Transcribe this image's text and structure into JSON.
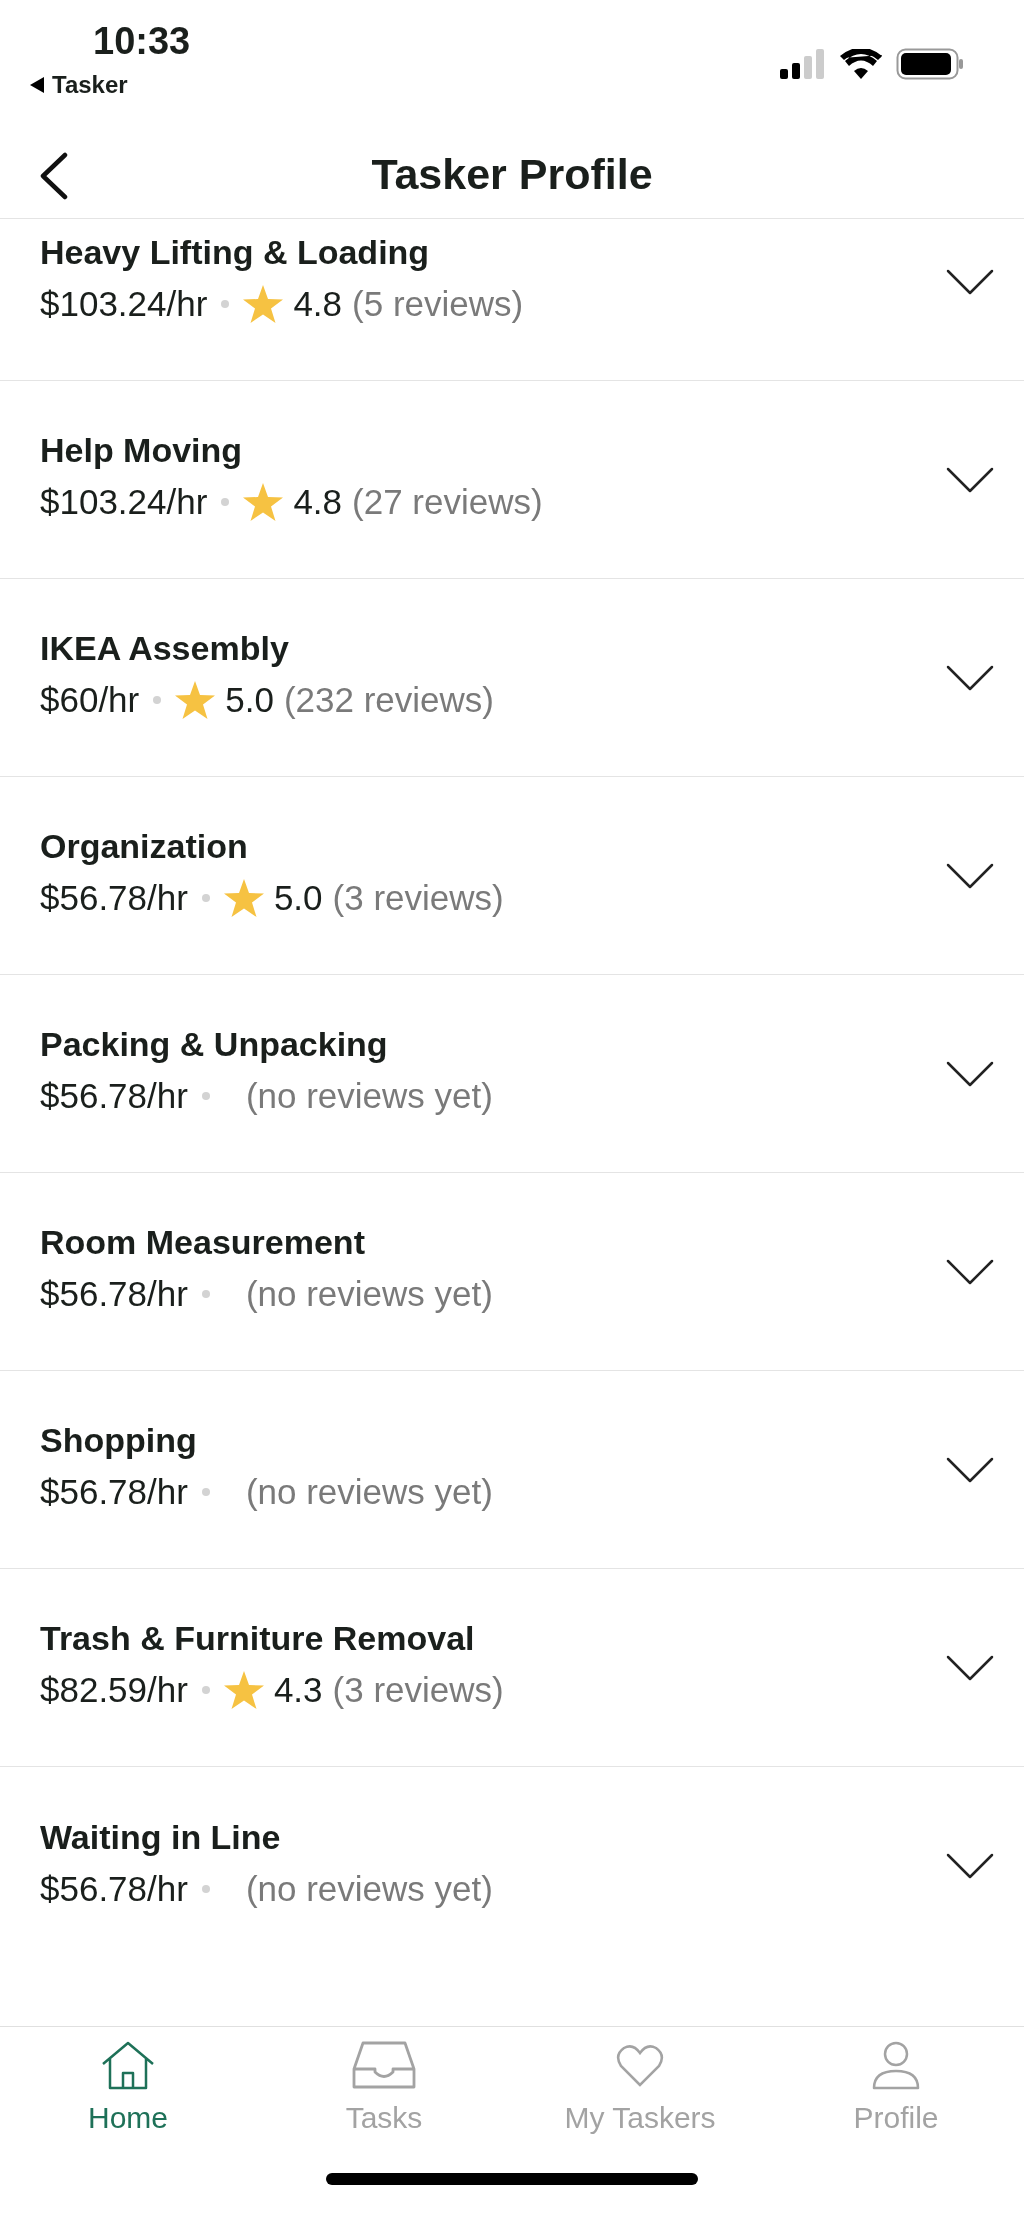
{
  "status_bar": {
    "time": "10:33",
    "back_app": "Tasker"
  },
  "header": {
    "title": "Tasker Profile"
  },
  "skills": [
    {
      "name": "Heavy Lifting & Loading",
      "rate": "$103.24/hr",
      "rating": "4.8",
      "reviews": "(5 reviews)"
    },
    {
      "name": "Help Moving",
      "rate": "$103.24/hr",
      "rating": "4.8",
      "reviews": "(27 reviews)"
    },
    {
      "name": "IKEA Assembly",
      "rate": "$60/hr",
      "rating": "5.0",
      "reviews": "(232 reviews)"
    },
    {
      "name": "Organization",
      "rate": "$56.78/hr",
      "rating": "5.0",
      "reviews": "(3 reviews)"
    },
    {
      "name": "Packing & Unpacking",
      "rate": "$56.78/hr",
      "reviews": "(no reviews yet)"
    },
    {
      "name": "Room Measurement",
      "rate": "$56.78/hr",
      "reviews": "(no reviews yet)"
    },
    {
      "name": "Shopping",
      "rate": "$56.78/hr",
      "reviews": "(no reviews yet)"
    },
    {
      "name": "Trash & Furniture Removal",
      "rate": "$82.59/hr",
      "rating": "4.3",
      "reviews": "(3 reviews)"
    },
    {
      "name": "Waiting in Line",
      "rate": "$56.78/hr",
      "reviews": "(no reviews yet)"
    }
  ],
  "tabs": [
    {
      "kind": "home",
      "label": "Home",
      "selected": true
    },
    {
      "kind": "tasks",
      "label": "Tasks",
      "selected": false
    },
    {
      "kind": "heart",
      "label": "My Taskers",
      "selected": false
    },
    {
      "kind": "person",
      "label": "Profile",
      "selected": false
    }
  ]
}
